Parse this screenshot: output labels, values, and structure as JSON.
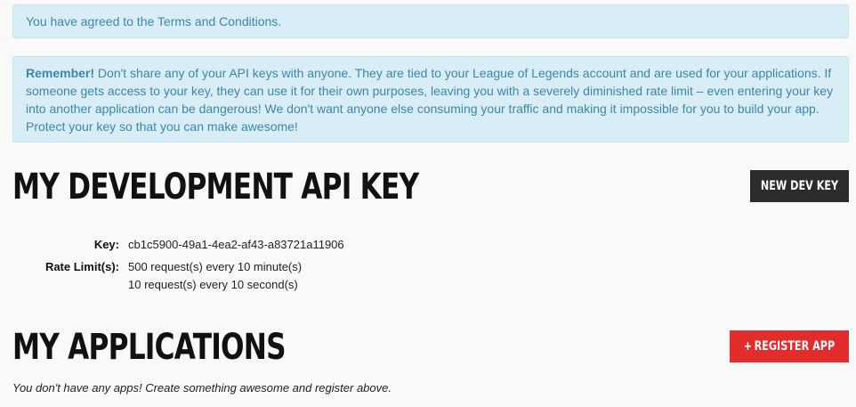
{
  "alerts": {
    "agreed": "You have agreed to the Terms and Conditions.",
    "remember_label": "Remember!",
    "remember_text": " Don't share any of your API keys with anyone. They are tied to your League of Legends account and are used for your applications. If someone gets access to your key, they can use it for their own purposes, leaving you with a severely diminished rate limit – even entering your key into another application can be dangerous! We don't want anyone else consuming your traffic and making it impossible for you to build your app. Protect your key so that you can make awesome!"
  },
  "dev_key": {
    "title": "MY DEVELOPMENT API KEY",
    "new_key_button": "NEW DEV KEY",
    "key_label": "Key:",
    "key_value": "cb1c5900-49a1-4ea2-af43-a83721a11906",
    "rate_label": "Rate Limit(s):",
    "rate_limits": [
      "500 request(s) every 10 minute(s)",
      "10 request(s) every 10 second(s)"
    ]
  },
  "applications": {
    "title": "MY APPLICATIONS",
    "register_button": "REGISTER APP",
    "register_icon": "plus-icon",
    "empty_message": "You don't have any apps! Create something awesome and register above."
  },
  "colors": {
    "alert_bg": "#d9edf7",
    "alert_text": "#3a87ad",
    "dark_button": "#2c2c2c",
    "red_button": "#e32d2d"
  }
}
